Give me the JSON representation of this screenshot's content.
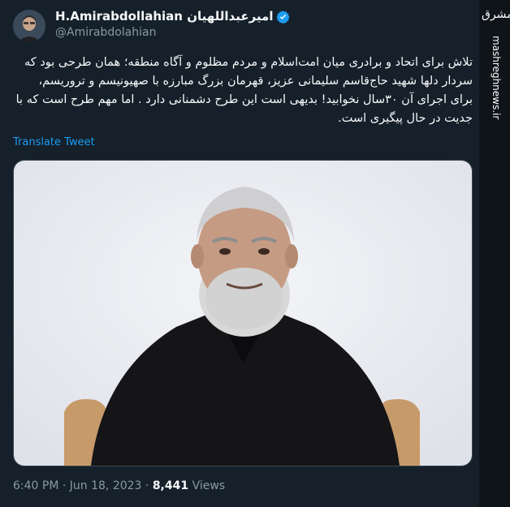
{
  "tweet": {
    "display_name": "H.Amirabdollahian امیرعبداللهیان",
    "handle": "@Amirabdolahian",
    "more_icon": "more-dots-icon",
    "body": "تلاش برای اتحاد و برادری میان امت‌اسلام و مردم مظلوم و آگاه منطقه؛ همان طرحی بود که سردار دلها شهید حاج‌قاسم سلیمانی عزیز، قهرمان بزرگ مبارزه با صهیونیسم و تروریسم، برای اجرای آن ۳۰سال نخوابید! بدیهی است این طرح دشمنانی دارد . اما مهم طرح است که با جدیت در حال پیگیری است.",
    "translate_label": "Translate Tweet",
    "time": "6:40 PM",
    "date": "Jun 18, 2023",
    "views_count": "8,441",
    "views_label": "Views",
    "separator": "·"
  },
  "watermark": {
    "logo_text": "مشرق",
    "site": "mashreghnews.ir"
  },
  "colors": {
    "background": "#15202b",
    "link": "#1d9bf0",
    "verified": "#1d9bf0",
    "secondary_text": "#8b98a5"
  }
}
